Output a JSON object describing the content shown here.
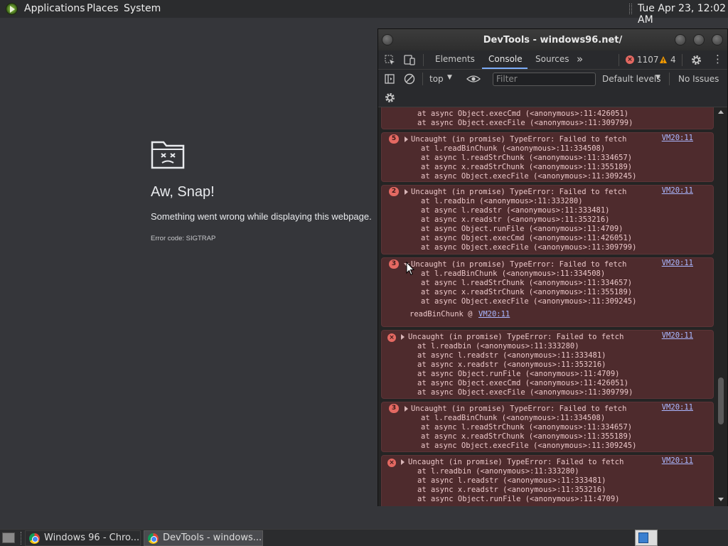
{
  "top_panel": {
    "menus": [
      "Applications",
      "Places",
      "System"
    ],
    "clock": "Tue Apr 23, 12:02 AM"
  },
  "crash_page": {
    "title": "Aw, Snap!",
    "message": "Something went wrong while displaying this webpage.",
    "error_code": "Error code: SIGTRAP"
  },
  "devtools": {
    "window_title": "DevTools - windows96.net/",
    "tabs": [
      "Elements",
      "Console",
      "Sources"
    ],
    "active_tab": "Console",
    "error_count": "1107",
    "warning_count": "4",
    "context": "top",
    "filter_placeholder": "Filter",
    "levels": "Default levels",
    "issues": "No Issues",
    "messages": [
      {
        "lines": [
          "at async Object.execCmd (<anonymous>:11:426051)",
          "at async Object.execFile (<anonymous>:11:309799)"
        ]
      },
      {
        "count": "5",
        "header": "Uncaught (in promise) TypeError: Failed to fetch",
        "source": "VM20:11",
        "lines": [
          "at l.readBinChunk (<anonymous>:11:334508)",
          "at async l.readStrChunk (<anonymous>:11:334657)",
          "at async x.readStrChunk (<anonymous>:11:355189)",
          "at async Object.execFile (<anonymous>:11:309245)"
        ]
      },
      {
        "count": "2",
        "header": "Uncaught (in promise) TypeError: Failed to fetch",
        "source": "VM20:11",
        "lines": [
          "at l.readbin (<anonymous>:11:333280)",
          "at async l.readstr (<anonymous>:11:333481)",
          "at async x.readstr (<anonymous>:11:353216)",
          "at async Object.runFile (<anonymous>:11:4709)",
          "at async Object.execCmd (<anonymous>:11:426051)",
          "at async Object.execFile (<anonymous>:11:309799)"
        ]
      },
      {
        "count": "3",
        "header": "Uncaught (in promise) TypeError: Failed to fetch",
        "source": "VM20:11",
        "lines": [
          "at l.readBinChunk (<anonymous>:11:334508)",
          "at async l.readStrChunk (<anonymous>:11:334657)",
          "at async x.readStrChunk (<anonymous>:11:355189)",
          "at async Object.execFile (<anonymous>:11:309245)"
        ],
        "footer_fn": "readBinChunk @",
        "footer_link": "VM20:11"
      },
      {
        "header": "Uncaught (in promise) TypeError: Failed to fetch",
        "source": "VM20:11",
        "lines": [
          "at l.readbin (<anonymous>:11:333280)",
          "at async l.readstr (<anonymous>:11:333481)",
          "at async x.readstr (<anonymous>:11:353216)",
          "at async Object.runFile (<anonymous>:11:4709)",
          "at async Object.execCmd (<anonymous>:11:426051)",
          "at async Object.execFile (<anonymous>:11:309799)"
        ]
      },
      {
        "count": "3",
        "header": "Uncaught (in promise) TypeError: Failed to fetch",
        "source": "VM20:11",
        "lines": [
          "at l.readBinChunk (<anonymous>:11:334508)",
          "at async l.readStrChunk (<anonymous>:11:334657)",
          "at async x.readStrChunk (<anonymous>:11:355189)",
          "at async Object.execFile (<anonymous>:11:309245)"
        ]
      },
      {
        "header": "Uncaught (in promise) TypeError: Failed to fetch",
        "source": "VM20:11",
        "lines": [
          "at l.readbin (<anonymous>:11:333280)",
          "at async l.readstr (<anonymous>:11:333481)",
          "at async x.readstr (<anonymous>:11:353216)",
          "at async Object.runFile (<anonymous>:11:4709)"
        ]
      }
    ]
  },
  "taskbar": {
    "tasks": [
      "Windows 96 - Chro...",
      "DevTools - windows..."
    ]
  }
}
